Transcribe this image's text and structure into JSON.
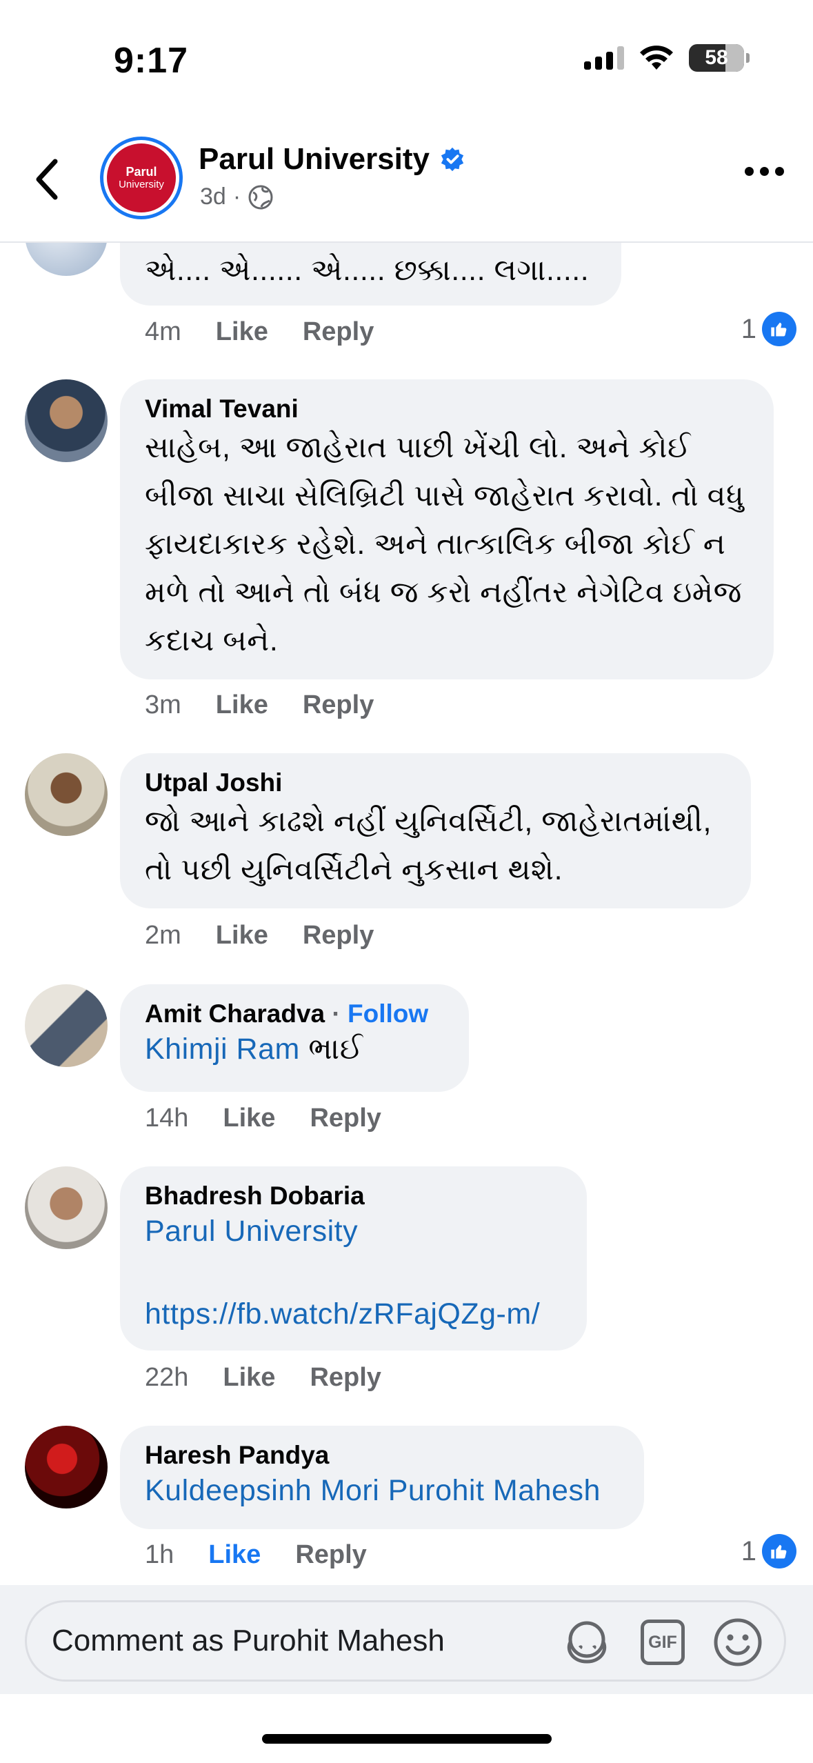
{
  "status_bar": {
    "time": "9:17",
    "battery": "58"
  },
  "header": {
    "page_name": "Parul University",
    "avatar_text_top": "Parul",
    "avatar_text_bottom": "University",
    "age": "3d",
    "separator": "·"
  },
  "comments": [
    {
      "id": "c0",
      "author": "",
      "text": "એ.... એ...... એ..... છક્કા.... લગા.....",
      "time": "4m",
      "like": "Like",
      "reply": "Reply",
      "reaction_count": "1"
    },
    {
      "id": "c1",
      "author": "Vimal Tevani",
      "text": "સાહેબ, આ જાહેરાત પાછી ખેંચી લો. અને કોઈ બીજા સાચા સેલિબ્રિટી પાસે જાહેરાત કરાવો. તો વધુ ફાયદાકારક રહેશે. અને તાત્કાલિક બીજા કોઈ ન મળે તો આને તો બંધ જ કરો નહીંતર નેગેટિવ ઇમેજ કદાચ બને.",
      "time": "3m",
      "like": "Like",
      "reply": "Reply"
    },
    {
      "id": "c2",
      "author": "Utpal Joshi",
      "text": "જો આને કાઢશે નહીં યુનિવર્સિટી, જાહેરાતમાંથી, તો પછી યુનિવર્સિટીને નુકસાન થશે.",
      "time": "2m",
      "like": "Like",
      "reply": "Reply"
    },
    {
      "id": "c3",
      "author": "Amit Charadva",
      "follow_sep": " · ",
      "follow": "Follow",
      "mention": "Khimji Ram",
      "text": " ભાઈ",
      "time": "14h",
      "like": "Like",
      "reply": "Reply"
    },
    {
      "id": "c4",
      "author": "Bhadresh Dobaria",
      "mention": "Parul University",
      "url": "https://fb.watch/zRFajQZg-m/",
      "time": "22h",
      "like": "Like",
      "reply": "Reply"
    },
    {
      "id": "c5",
      "author": "Haresh Pandya",
      "mention": "Kuldeepsinh Mori Purohit Mahesh",
      "time": "1h",
      "like": "Like",
      "reply": "Reply",
      "liked": true,
      "reaction_count": "1"
    }
  ],
  "composer": {
    "placeholder": "Comment as Purohit Mahesh",
    "icons": [
      "avatar-sticker-icon",
      "gif-icon",
      "emoji-icon"
    ],
    "gif_label": "GIF"
  },
  "colors": {
    "accent": "#1877f2",
    "bubble": "#f0f2f5",
    "muted": "#65676b"
  }
}
